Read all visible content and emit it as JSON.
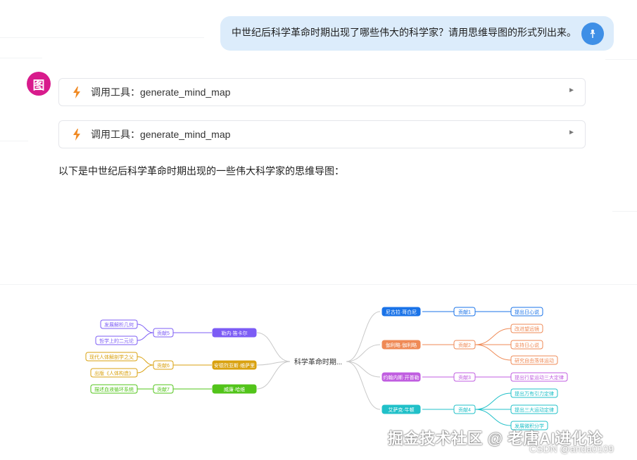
{
  "user_message": {
    "text": "中世纪后科学革命时期出现了哪些伟大的科学家？请用思维导图的形式列出来。"
  },
  "bot": {
    "avatar_text": "图"
  },
  "tool_calls": [
    {
      "label": "调用工具：generate_mind_map",
      "caret": "►"
    },
    {
      "label": "调用工具：generate_mind_map",
      "caret": "►"
    }
  ],
  "answer": {
    "intro": "以下是中世纪后科学革命时期出现的一些伟大科学家的思维导图："
  },
  "mind_map": {
    "root": "科学革命时期...",
    "right": [
      {
        "name": "尼古拉·哥白尼",
        "color": "#1a73e8",
        "contribution": {
          "label": "贡献1",
          "items": [
            "提出日心说"
          ]
        }
      },
      {
        "name": "伽利略·伽利略",
        "color": "#ef8a56",
        "contribution": {
          "label": "贡献2",
          "items": [
            "改进望远镜",
            "支持日心说",
            "研究自由落体运动"
          ]
        }
      },
      {
        "name": "约翰内斯·开普勒",
        "color": "#c05de0",
        "contribution": {
          "label": "贡献3",
          "items": [
            "提出行星运动三大定律"
          ]
        }
      },
      {
        "name": "艾萨克·牛顿",
        "color": "#20c0c8",
        "contribution": {
          "label": "贡献4",
          "items": [
            "提出万有引力定律",
            "提出三大运动定律",
            "发展微积分学"
          ]
        }
      }
    ],
    "left": [
      {
        "name": "勒内·笛卡尔",
        "color": "#7c5cf5",
        "contribution": {
          "label": "贡献5",
          "items": [
            "发展解析几何",
            "哲学上的二元论"
          ]
        }
      },
      {
        "name": "安德烈亚斯·维萨里",
        "color": "#d9a10f",
        "contribution": {
          "label": "贡献6",
          "items": [
            "现代人体解剖学之父",
            "出版《人体构造》"
          ]
        }
      },
      {
        "name": "威廉·哈维",
        "color": "#52c41a",
        "contribution": {
          "label": "贡献7",
          "items": [
            "描述血液循环系统"
          ]
        }
      }
    ]
  },
  "watermark": {
    "main": "掘金技术社区 @ 老唐AI进化论",
    "sub": "CSDN @anda0109"
  }
}
